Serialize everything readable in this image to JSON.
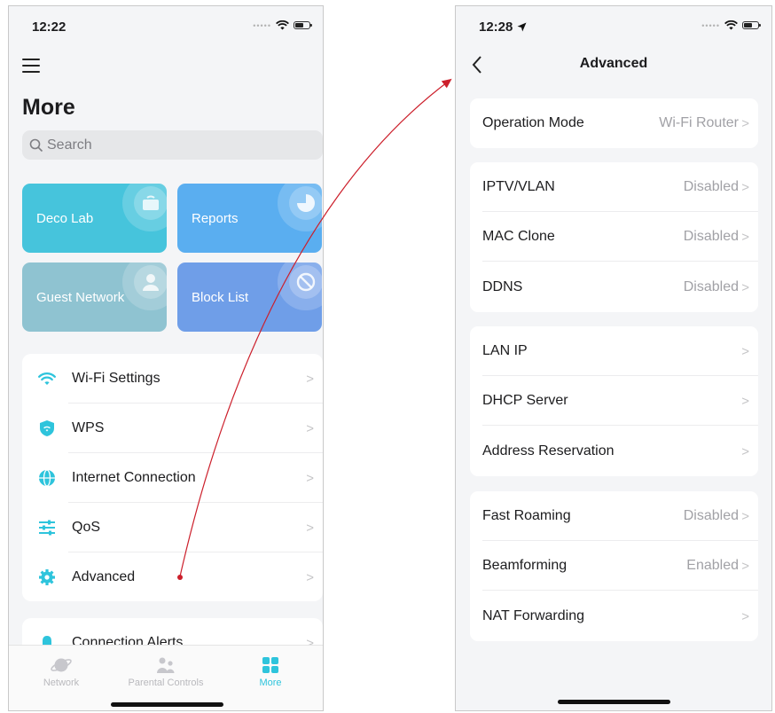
{
  "left": {
    "status_time": "12:22",
    "title": "More",
    "search_placeholder": "Search",
    "tiles": [
      {
        "label": "Deco Lab",
        "color": "#46c4dc"
      },
      {
        "label": "Reports",
        "color": "#5aaef0"
      },
      {
        "label": "Guest Network",
        "color": "#8fc3d1"
      },
      {
        "label": "Block List",
        "color": "#6f9ee8"
      }
    ],
    "list": [
      {
        "label": "Wi-Fi Settings",
        "icon": "wifi-icon"
      },
      {
        "label": "WPS",
        "icon": "shield-wifi-icon"
      },
      {
        "label": "Internet Connection",
        "icon": "globe-icon"
      },
      {
        "label": "QoS",
        "icon": "sliders-icon"
      },
      {
        "label": "Advanced",
        "icon": "gear-icon"
      }
    ],
    "partial_item": "Connection Alerts",
    "tabs": [
      {
        "label": "Network",
        "icon": "planet-icon"
      },
      {
        "label": "Parental Controls",
        "icon": "family-icon"
      },
      {
        "label": "More",
        "icon": "grid-icon"
      }
    ]
  },
  "right": {
    "status_time": "12:28",
    "nav_title": "Advanced",
    "groups": [
      [
        {
          "label": "Operation Mode",
          "value": "Wi-Fi Router"
        }
      ],
      [
        {
          "label": "IPTV/VLAN",
          "value": "Disabled"
        },
        {
          "label": "MAC Clone",
          "value": "Disabled"
        },
        {
          "label": "DDNS",
          "value": "Disabled"
        }
      ],
      [
        {
          "label": "LAN IP",
          "value": ""
        },
        {
          "label": "DHCP Server",
          "value": ""
        },
        {
          "label": "Address Reservation",
          "value": ""
        }
      ],
      [
        {
          "label": "Fast Roaming",
          "value": "Disabled"
        },
        {
          "label": "Beamforming",
          "value": "Enabled"
        },
        {
          "label": "NAT Forwarding",
          "value": ""
        }
      ]
    ]
  },
  "colors": {
    "accent": "#2ec4dc",
    "annotation_arrow": "#cc1f2b"
  }
}
